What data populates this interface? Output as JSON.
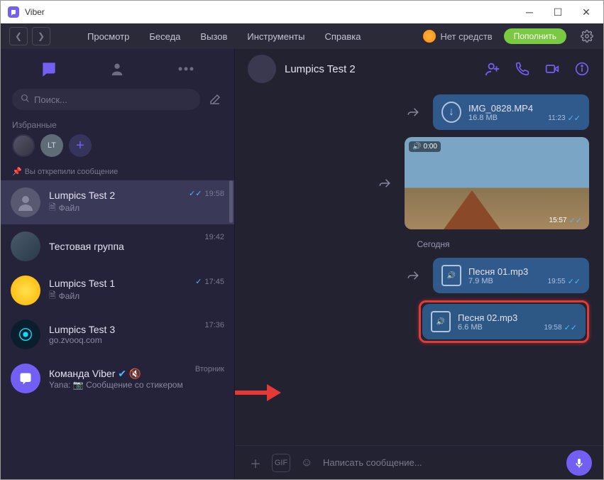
{
  "window": {
    "title": "Viber"
  },
  "menu": {
    "view": "Просмотр",
    "chat": "Беседа",
    "call": "Вызов",
    "tools": "Инструменты",
    "help": "Справка"
  },
  "balance": {
    "text": "Нет средств",
    "topup": "Пополнить"
  },
  "sidebar": {
    "search_placeholder": "Поиск...",
    "favorites_label": "Избранные",
    "fav_lt": "LT",
    "pinned_text": "Вы открепили сообщение",
    "chats": [
      {
        "name": "Lumpics Test 2",
        "preview": "Файл",
        "time": "19:58"
      },
      {
        "name": "Тестовая группа",
        "preview": "",
        "time": "19:42"
      },
      {
        "name": "Lumpics Test 1",
        "preview": "Файл",
        "time": "17:45"
      },
      {
        "name": "Lumpics Test 3",
        "preview": "go.zvooq.com",
        "time": "17:36"
      },
      {
        "name": "Команда Viber",
        "preview": "Yana: 📷 Сообщение со стикером",
        "time": "Вторник"
      }
    ]
  },
  "conversation": {
    "title": "Lumpics Test 2",
    "file1": {
      "name": "IMG_0828.MP4",
      "size": "16.8 MB",
      "time": "11:23"
    },
    "video": {
      "label": "0:00",
      "time": "15:57"
    },
    "date_divider": "Сегодня",
    "file2": {
      "name": "Песня 01.mp3",
      "size": "7.9 MB",
      "time": "19:55"
    },
    "file3": {
      "name": "Песня 02.mp3",
      "size": "6.6 MB",
      "time": "19:58"
    },
    "input_placeholder": "Написать сообщение..."
  }
}
